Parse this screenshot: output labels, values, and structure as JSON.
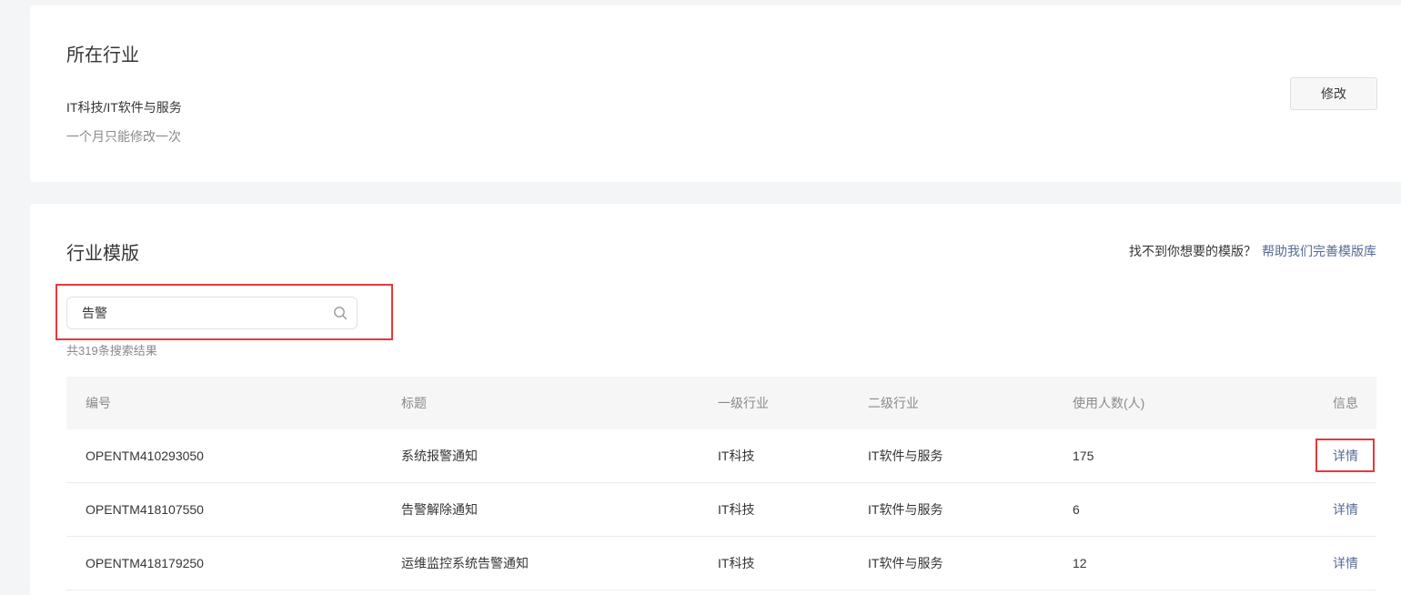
{
  "industry": {
    "title": "所在行业",
    "value": "IT科技/IT软件与服务",
    "hint": "一个月只能修改一次",
    "modify_label": "修改"
  },
  "templates": {
    "title": "行业模版",
    "help_question": "找不到你想要的模版？",
    "help_link": "帮助我们完善模版库",
    "search": {
      "value": "告警"
    },
    "result_count": "共319条搜索结果",
    "columns": {
      "id": "编号",
      "title": "标题",
      "level1": "一级行业",
      "level2": "二级行业",
      "users": "使用人数(人)",
      "info": "信息"
    },
    "rows": [
      {
        "id": "OPENTM410293050",
        "title": "系统报警通知",
        "level1": "IT科技",
        "level2": "IT软件与服务",
        "users": "175",
        "detail": "详情"
      },
      {
        "id": "OPENTM418107550",
        "title": "告警解除通知",
        "level1": "IT科技",
        "level2": "IT软件与服务",
        "users": "6",
        "detail": "详情"
      },
      {
        "id": "OPENTM418179250",
        "title": "运维监控系统告警通知",
        "level1": "IT科技",
        "level2": "IT软件与服务",
        "users": "12",
        "detail": "详情"
      }
    ]
  },
  "colors": {
    "link": "#576b95",
    "highlight": "#e5383b"
  }
}
